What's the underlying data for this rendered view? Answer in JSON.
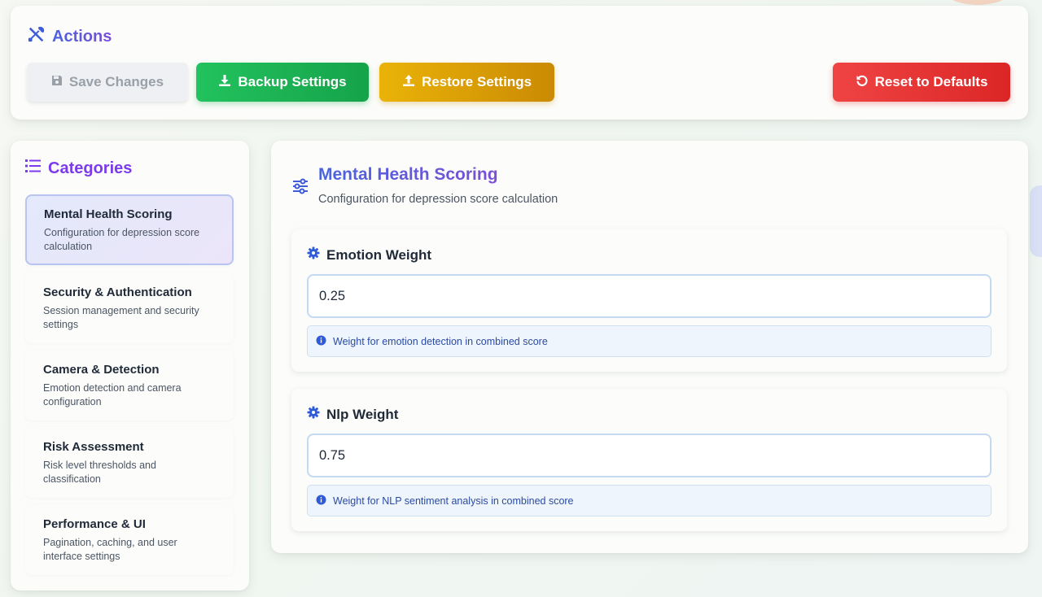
{
  "actions": {
    "title": "Actions",
    "save_label": "Save Changes",
    "backup_label": "Backup Settings",
    "restore_label": "Restore Settings",
    "reset_label": "Reset to Defaults"
  },
  "categories": {
    "title": "Categories",
    "items": [
      {
        "name": "Mental Health Scoring",
        "desc": "Configuration for depression score calculation",
        "active": true
      },
      {
        "name": "Security & Authentication",
        "desc": "Session management and security settings"
      },
      {
        "name": "Camera & Detection",
        "desc": "Emotion detection and camera configuration"
      },
      {
        "name": "Risk Assessment",
        "desc": "Risk level thresholds and classification"
      },
      {
        "name": "Performance & UI",
        "desc": "Pagination, caching, and user interface settings"
      }
    ]
  },
  "main": {
    "title": "Mental Health Scoring",
    "subtitle": "Configuration for depression score calculation",
    "settings": [
      {
        "label": "Emotion Weight",
        "value": "0.25",
        "help": "Weight for emotion detection in combined score"
      },
      {
        "label": "Nlp Weight",
        "value": "0.75",
        "help": "Weight for NLP sentiment analysis in combined score"
      }
    ]
  },
  "colors": {
    "accent_blue": "#4a63e0",
    "accent_purple": "#7c3aed",
    "success": "#16a34a",
    "warning": "#ca8a04",
    "danger": "#dc2626"
  },
  "icons": {
    "actions": "tools-icon",
    "save": "floppy-disk-icon",
    "backup": "download-icon",
    "restore": "upload-icon",
    "reset": "undo-icon",
    "categories": "list-icon",
    "main": "sliders-icon",
    "setting": "gear-icon",
    "help": "info-circle-icon"
  }
}
